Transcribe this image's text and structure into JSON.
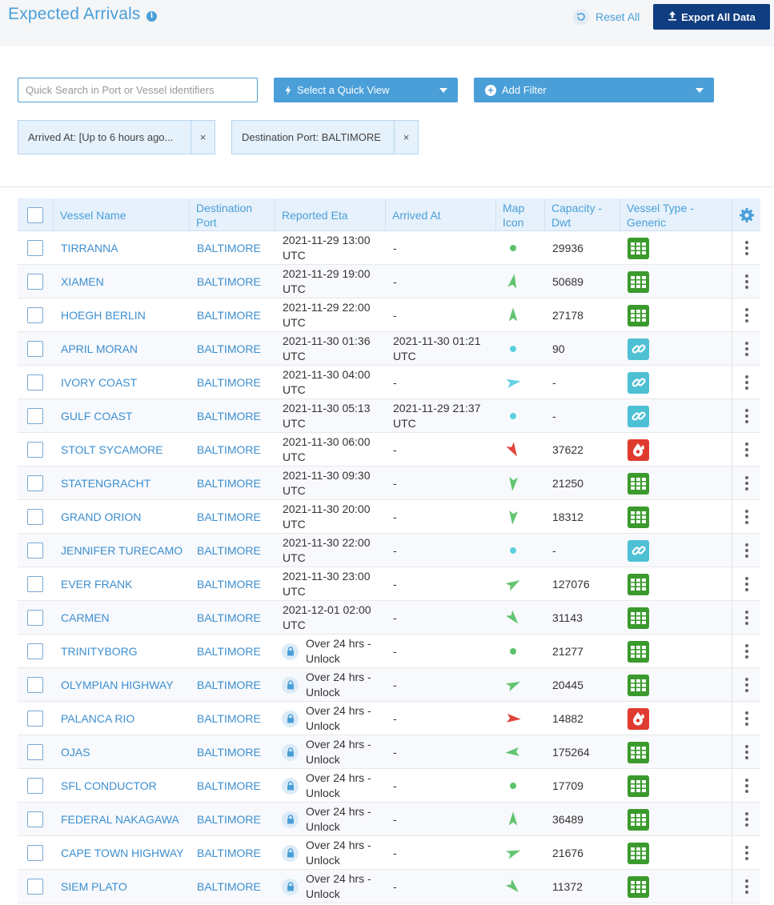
{
  "header": {
    "title": "Expected Arrivals",
    "reset_label": "Reset All",
    "export_label": "Export All Data"
  },
  "toolbar": {
    "search_placeholder": "Quick Search in Port or Vessel identifiers",
    "search_value": "",
    "quick_view_label": "Select a Quick View",
    "add_filter_label": "Add Filter"
  },
  "filters": [
    {
      "label": "Arrived At: [Up to 6 hours ago..."
    },
    {
      "label": "Destination Port: BALTIMORE"
    }
  ],
  "table": {
    "columns": {
      "vessel_name": "Vessel Name",
      "destination_port": "Destination Port",
      "reported_eta": "Reported Eta",
      "arrived_at": "Arrived At",
      "map_icon": "Map Icon",
      "capacity": "Capacity - Dwt",
      "vessel_type": "Vessel Type - Generic"
    },
    "rows": [
      {
        "name": "TIRRANNA",
        "port": "BALTIMORE",
        "eta": "2021-11-29 13:00 UTC",
        "locked": false,
        "arrived": "-",
        "icon": "dot",
        "icon_color": "#5cc26a",
        "icon_rot": 0,
        "capacity": "29936",
        "type": "cargo"
      },
      {
        "name": "XIAMEN",
        "port": "BALTIMORE",
        "eta": "2021-11-29 19:00 UTC",
        "locked": false,
        "arrived": "-",
        "icon": "arrow",
        "icon_color": "#5cc26a",
        "icon_rot": 10,
        "capacity": "50689",
        "type": "cargo"
      },
      {
        "name": "HOEGH BERLIN",
        "port": "BALTIMORE",
        "eta": "2021-11-29 22:00 UTC",
        "locked": false,
        "arrived": "-",
        "icon": "arrow",
        "icon_color": "#5cc26a",
        "icon_rot": 0,
        "capacity": "27178",
        "type": "cargo"
      },
      {
        "name": "APRIL MORAN",
        "port": "BALTIMORE",
        "eta": "2021-11-30 01:36 UTC",
        "locked": false,
        "arrived": "2021-11-30 01:21 UTC",
        "icon": "dot",
        "icon_color": "#5ccfe0",
        "icon_rot": 0,
        "capacity": "90",
        "type": "passenger"
      },
      {
        "name": "IVORY COAST",
        "port": "BALTIMORE",
        "eta": "2021-11-30 04:00 UTC",
        "locked": false,
        "arrived": "-",
        "icon": "arrow",
        "icon_color": "#5ccfe0",
        "icon_rot": 80,
        "capacity": "-",
        "type": "passenger"
      },
      {
        "name": "GULF COAST",
        "port": "BALTIMORE",
        "eta": "2021-11-30 05:13 UTC",
        "locked": false,
        "arrived": "2021-11-29 21:37 UTC",
        "icon": "dot",
        "icon_color": "#5ccfe0",
        "icon_rot": 0,
        "capacity": "-",
        "type": "passenger"
      },
      {
        "name": "STOLT SYCAMORE",
        "port": "BALTIMORE",
        "eta": "2021-11-30 06:00 UTC",
        "locked": false,
        "arrived": "-",
        "icon": "arrow",
        "icon_color": "#e03b2f",
        "icon_rot": 150,
        "capacity": "37622",
        "type": "tanker"
      },
      {
        "name": "STATENGRACHT",
        "port": "BALTIMORE",
        "eta": "2021-11-30 09:30 UTC",
        "locked": false,
        "arrived": "-",
        "icon": "arrow",
        "icon_color": "#5cc26a",
        "icon_rot": 185,
        "capacity": "21250",
        "type": "cargo"
      },
      {
        "name": "GRAND ORION",
        "port": "BALTIMORE",
        "eta": "2021-11-30 20:00 UTC",
        "locked": false,
        "arrived": "-",
        "icon": "arrow",
        "icon_color": "#5cc26a",
        "icon_rot": 185,
        "capacity": "18312",
        "type": "cargo"
      },
      {
        "name": "JENNIFER TURECAMO",
        "port": "BALTIMORE",
        "eta": "2021-11-30 22:00 UTC",
        "locked": false,
        "arrived": "-",
        "icon": "dot",
        "icon_color": "#5ccfe0",
        "icon_rot": 0,
        "capacity": "-",
        "type": "passenger"
      },
      {
        "name": "EVER FRANK",
        "port": "BALTIMORE",
        "eta": "2021-11-30 23:00 UTC",
        "locked": false,
        "arrived": "-",
        "icon": "arrow",
        "icon_color": "#5cc26a",
        "icon_rot": 60,
        "capacity": "127076",
        "type": "cargo"
      },
      {
        "name": "CARMEN",
        "port": "BALTIMORE",
        "eta": "2021-12-01 02:00 UTC",
        "locked": false,
        "arrived": "-",
        "icon": "arrow",
        "icon_color": "#5cc26a",
        "icon_rot": 140,
        "capacity": "31143",
        "type": "cargo"
      },
      {
        "name": "TRINITYBORG",
        "port": "BALTIMORE",
        "eta": "Over 24 hrs - Unlock",
        "locked": true,
        "arrived": "-",
        "icon": "dot",
        "icon_color": "#5cc26a",
        "icon_rot": 0,
        "capacity": "21277",
        "type": "cargo"
      },
      {
        "name": "OLYMPIAN HIGHWAY",
        "port": "BALTIMORE",
        "eta": "Over 24 hrs - Unlock",
        "locked": true,
        "arrived": "-",
        "icon": "arrow",
        "icon_color": "#5cc26a",
        "icon_rot": 65,
        "capacity": "20445",
        "type": "cargo"
      },
      {
        "name": "PALANCA RIO",
        "port": "BALTIMORE",
        "eta": "Over 24 hrs - Unlock",
        "locked": true,
        "arrived": "-",
        "icon": "arrow",
        "icon_color": "#e03b2f",
        "icon_rot": 95,
        "capacity": "14882",
        "type": "tanker"
      },
      {
        "name": "OJAS",
        "port": "BALTIMORE",
        "eta": "Over 24 hrs - Unlock",
        "locked": true,
        "arrived": "-",
        "icon": "arrow",
        "icon_color": "#5cc26a",
        "icon_rot": 265,
        "capacity": "175264",
        "type": "cargo"
      },
      {
        "name": "SFL CONDUCTOR",
        "port": "BALTIMORE",
        "eta": "Over 24 hrs - Unlock",
        "locked": true,
        "arrived": "-",
        "icon": "dot",
        "icon_color": "#5cc26a",
        "icon_rot": 0,
        "capacity": "17709",
        "type": "cargo"
      },
      {
        "name": "FEDERAL NAKAGAWA",
        "port": "BALTIMORE",
        "eta": "Over 24 hrs - Unlock",
        "locked": true,
        "arrived": "-",
        "icon": "arrow",
        "icon_color": "#5cc26a",
        "icon_rot": 0,
        "capacity": "36489",
        "type": "cargo"
      },
      {
        "name": "CAPE TOWN HIGHWAY",
        "port": "BALTIMORE",
        "eta": "Over 24 hrs - Unlock",
        "locked": true,
        "arrived": "-",
        "icon": "arrow",
        "icon_color": "#5cc26a",
        "icon_rot": 70,
        "capacity": "21676",
        "type": "cargo"
      },
      {
        "name": "SIEM PLATO",
        "port": "BALTIMORE",
        "eta": "Over 24 hrs - Unlock",
        "locked": true,
        "arrived": "-",
        "icon": "arrow",
        "icon_color": "#5cc26a",
        "icon_rot": 135,
        "capacity": "11372",
        "type": "cargo"
      }
    ]
  }
}
